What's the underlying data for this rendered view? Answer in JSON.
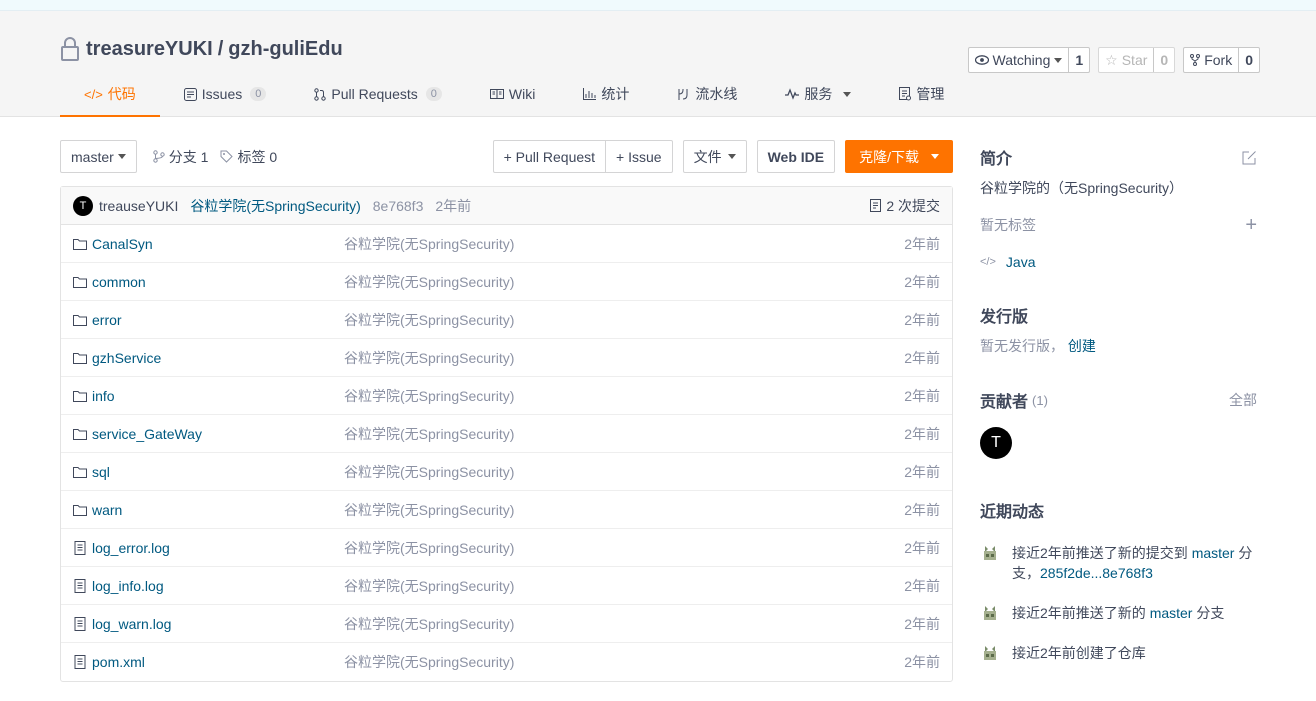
{
  "repo": {
    "owner": "treasureYUKI",
    "separator": "/",
    "name": "gzh-guliEdu"
  },
  "actions": {
    "watch": {
      "label": "Watching",
      "count": "1"
    },
    "star": {
      "label": "Star",
      "count": "0"
    },
    "fork": {
      "label": "Fork",
      "count": "0"
    }
  },
  "tabs": [
    {
      "label": "代码",
      "icon": "code-icon",
      "active": true
    },
    {
      "label": "Issues",
      "badge": "0",
      "icon": "issues-icon"
    },
    {
      "label": "Pull Requests",
      "badge": "0",
      "icon": "pull-request-icon"
    },
    {
      "label": "Wiki",
      "icon": "book-icon"
    },
    {
      "label": "统计",
      "icon": "bar-chart-icon"
    },
    {
      "label": "流水线",
      "icon": "pipeline-icon"
    },
    {
      "label": "服务",
      "icon": "pulse-icon"
    },
    {
      "label": "管理",
      "icon": "settings-doc-icon"
    }
  ],
  "toolbar": {
    "branch": "master",
    "branches": "分支 1",
    "tags": "标签 0",
    "pull_request": "+ Pull Request",
    "issue": "+ Issue",
    "file": "文件",
    "web_ide": "Web IDE",
    "clone": "克隆/下载"
  },
  "commit": {
    "avatar_letter": "T",
    "author": "treauseYUKI",
    "message": "谷粒学院(无SpringSecurity)",
    "sha": "8e768f3",
    "time": "2年前",
    "count": "2 次提交"
  },
  "files": [
    {
      "type": "folder",
      "name": "CanalSyn",
      "message": "谷粒学院(无SpringSecurity)",
      "time": "2年前"
    },
    {
      "type": "folder",
      "name": "common",
      "message": "谷粒学院(无SpringSecurity)",
      "time": "2年前"
    },
    {
      "type": "folder",
      "name": "error",
      "message": "谷粒学院(无SpringSecurity)",
      "time": "2年前"
    },
    {
      "type": "folder",
      "name": "gzhService",
      "message": "谷粒学院(无SpringSecurity)",
      "time": "2年前"
    },
    {
      "type": "folder",
      "name": "info",
      "message": "谷粒学院(无SpringSecurity)",
      "time": "2年前"
    },
    {
      "type": "folder",
      "name": "service_GateWay",
      "message": "谷粒学院(无SpringSecurity)",
      "time": "2年前"
    },
    {
      "type": "folder",
      "name": "sql",
      "message": "谷粒学院(无SpringSecurity)",
      "time": "2年前"
    },
    {
      "type": "folder",
      "name": "warn",
      "message": "谷粒学院(无SpringSecurity)",
      "time": "2年前"
    },
    {
      "type": "file",
      "name": "log_error.log",
      "message": "谷粒学院(无SpringSecurity)",
      "time": "2年前"
    },
    {
      "type": "file",
      "name": "log_info.log",
      "message": "谷粒学院(无SpringSecurity)",
      "time": "2年前"
    },
    {
      "type": "file",
      "name": "log_warn.log",
      "message": "谷粒学院(无SpringSecurity)",
      "time": "2年前"
    },
    {
      "type": "file",
      "name": "pom.xml",
      "message": "谷粒学院(无SpringSecurity)",
      "time": "2年前"
    }
  ],
  "sidebar": {
    "intro_title": "简介",
    "intro_text": "谷粒学院的（无SpringSecurity）",
    "no_tags": "暂无标签",
    "language": "Java",
    "release_title": "发行版",
    "no_release": "暂无发行版，",
    "create": "创建",
    "contributors_title": "贡献者",
    "contributors_count": "(1)",
    "all": "全部",
    "contributor_letter": "T",
    "activity_title": "近期动态",
    "activities": [
      {
        "text": "接近2年前推送了新的提交到",
        "link": "master",
        "suffix": " 分支，",
        "link2": "285f2de...8e768f3"
      },
      {
        "text": "接近2年前推送了新的",
        "link": "master",
        "suffix": " 分支",
        "link2": ""
      },
      {
        "text": "接近2年前创建了仓库",
        "link": "",
        "suffix": "",
        "link2": ""
      }
    ]
  },
  "colors": {
    "accent": "#fe7300",
    "link": "#005980",
    "muted": "#8c92a4"
  }
}
